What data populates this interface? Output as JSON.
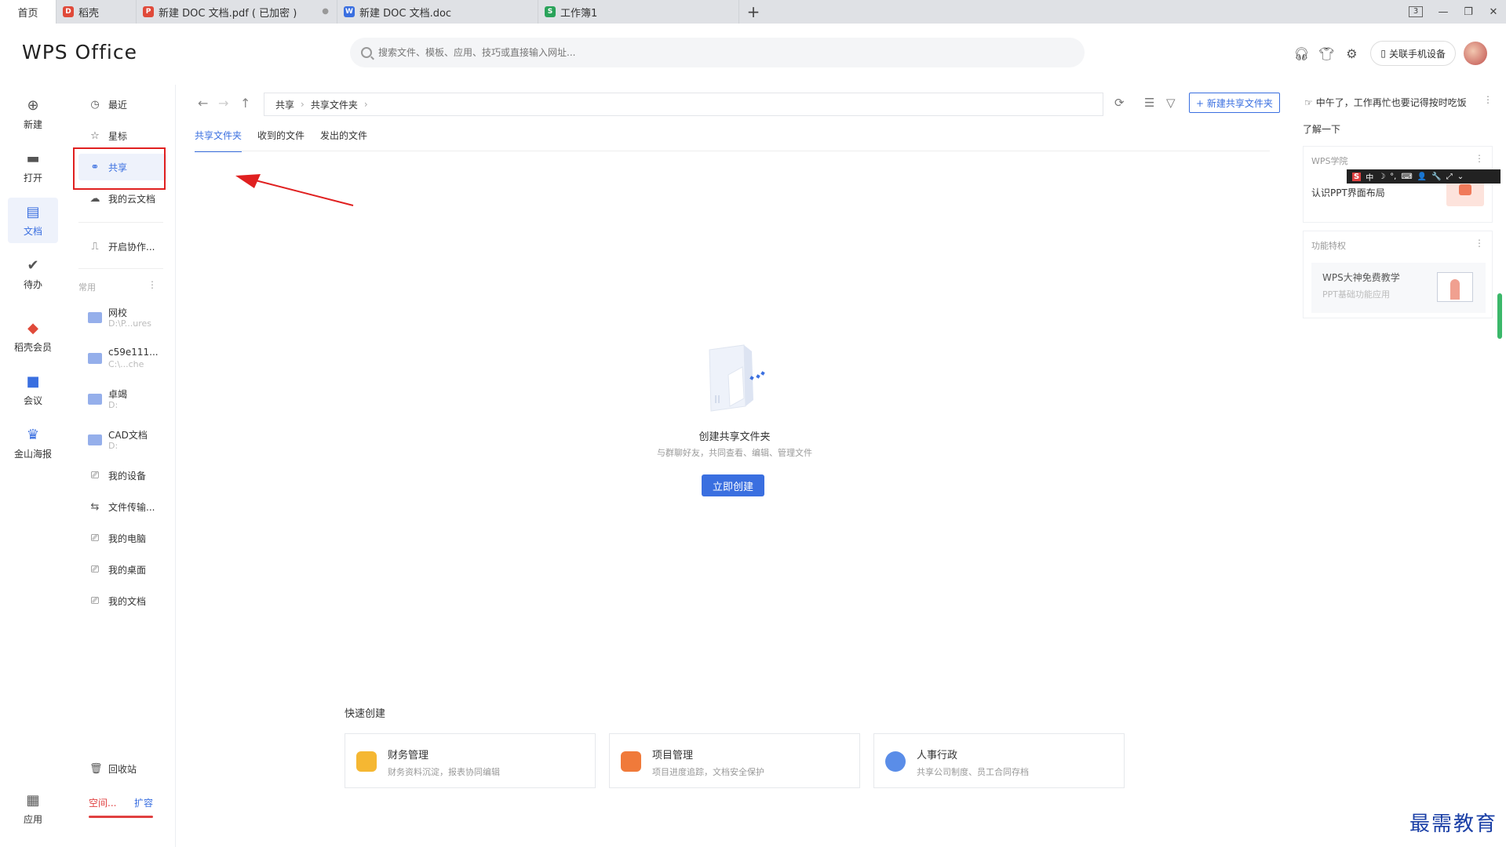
{
  "tabs": [
    {
      "label": "首页",
      "icon": "",
      "color": ""
    },
    {
      "label": "稻壳",
      "icon": "docer-icon",
      "color": "#e04a3a"
    },
    {
      "label": "新建 DOC 文档.pdf ( 已加密 )",
      "icon": "pdf-icon",
      "color": "#e04a3a"
    },
    {
      "label": "新建 DOC 文档.doc",
      "icon": "word-icon",
      "color": "#3a6fe0"
    },
    {
      "label": "工作簿1",
      "icon": "sheet-icon",
      "color": "#2aa35a"
    }
  ],
  "tab_glyphs": {
    "docer": "D",
    "pdf": "P",
    "word": "W",
    "sheet": "S"
  },
  "window_controls": {
    "count": "3",
    "minimize": "—",
    "restore": "❐",
    "close": "✕"
  },
  "newtab": "+",
  "header": {
    "logo": "WPS Office",
    "search_placeholder": "搜索文件、模板、应用、技巧或直接输入网址...",
    "link_phone": "关联手机设备"
  },
  "rail": [
    {
      "label": "新建",
      "icon": "plus-circle-icon"
    },
    {
      "label": "打开",
      "icon": "folder-open-icon"
    },
    {
      "label": "文档",
      "icon": "document-icon",
      "active": true
    },
    {
      "label": "待办",
      "icon": "check-icon"
    },
    {
      "label": "稻壳会员",
      "icon": "docer-icon"
    },
    {
      "label": "会议",
      "icon": "meeting-icon"
    },
    {
      "label": "金山海报",
      "icon": "poster-icon"
    },
    {
      "label": "应用",
      "icon": "apps-grid-icon"
    }
  ],
  "nav": {
    "recent": "最近",
    "star": "星标",
    "share": "共享",
    "cloud": "我的云文档",
    "collab": "开启协作...",
    "common_heading": "常用",
    "folders": [
      {
        "name": "网校",
        "path": "D:\\P...ures"
      },
      {
        "name": "c59e111...",
        "path": "C:\\...che"
      },
      {
        "name": "卓竭",
        "path": "D:"
      },
      {
        "name": "CAD文档",
        "path": "D:"
      }
    ],
    "devices": [
      "我的设备",
      "文件传输...",
      "我的电脑",
      "我的桌面",
      "我的文档"
    ],
    "recycle": "回收站",
    "space": "空间...",
    "expand": "扩容"
  },
  "main": {
    "breadcrumb": [
      "共享",
      "共享文件夹"
    ],
    "new_share_btn": "+ 新建共享文件夹",
    "subtabs": [
      "共享文件夹",
      "收到的文件",
      "发出的文件"
    ],
    "empty_title": "创建共享文件夹",
    "empty_desc": "与群聊好友，共同查看、编辑、管理文件",
    "create_btn": "立即创建",
    "quick_title": "快速创建",
    "quick": [
      {
        "name": "财务管理",
        "desc": "财务资料沉淀，报表协同编辑",
        "color": "#f5b732"
      },
      {
        "name": "项目管理",
        "desc": "项目进度追踪，文档安全保护",
        "color": "#f07a3a"
      },
      {
        "name": "人事行政",
        "desc": "共享公司制度、员工合同存档",
        "color": "#5a8de8"
      }
    ]
  },
  "right": {
    "greeting": "中午了，工作再忙也要记得按时吃饭",
    "learn": "了解一下",
    "card1_title": "WPS学院",
    "card1_text": "认识PPT界面布局",
    "card2_title": "功能特权",
    "card2_ft1": "WPS大神免费教学",
    "card2_ft2": "PPT基础功能应用",
    "ime": [
      "S",
      "中",
      "☽",
      "°,",
      "⌨",
      "👤",
      "🔧",
      "⤢",
      "⌄"
    ]
  },
  "watermark": "最需教育"
}
